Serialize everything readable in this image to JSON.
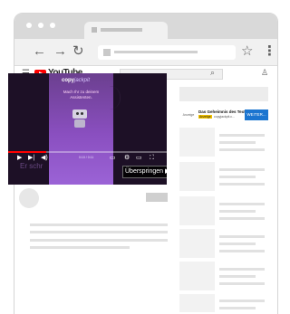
{
  "browser": {
    "nav": {
      "back_icon": "arrow-left-icon",
      "forward_icon": "arrow-right-icon",
      "reload_icon": "reload-icon"
    },
    "star_icon": "star-icon",
    "menu_icon": "kebab-menu-icon"
  },
  "youtube": {
    "logo_text": "YouTube",
    "brand_color": "#ff0000"
  },
  "video": {
    "overlay_logo": "copy",
    "overlay_logo_italic": "jackpit",
    "overlay_text": "Mach Ihr zu deinem Assistenten.",
    "ghost_text": "Er schr",
    "timecode": "0:10 / 0:11",
    "skip_label": "Überspringen ▶|",
    "progress_fraction": 0.24
  },
  "ad": {
    "thumb_label": "Anzeige",
    "title": "Das Geheimnis des Text...",
    "badge": "Anzeige",
    "url": "copyjackpit.c...",
    "button": "WEITER..."
  }
}
